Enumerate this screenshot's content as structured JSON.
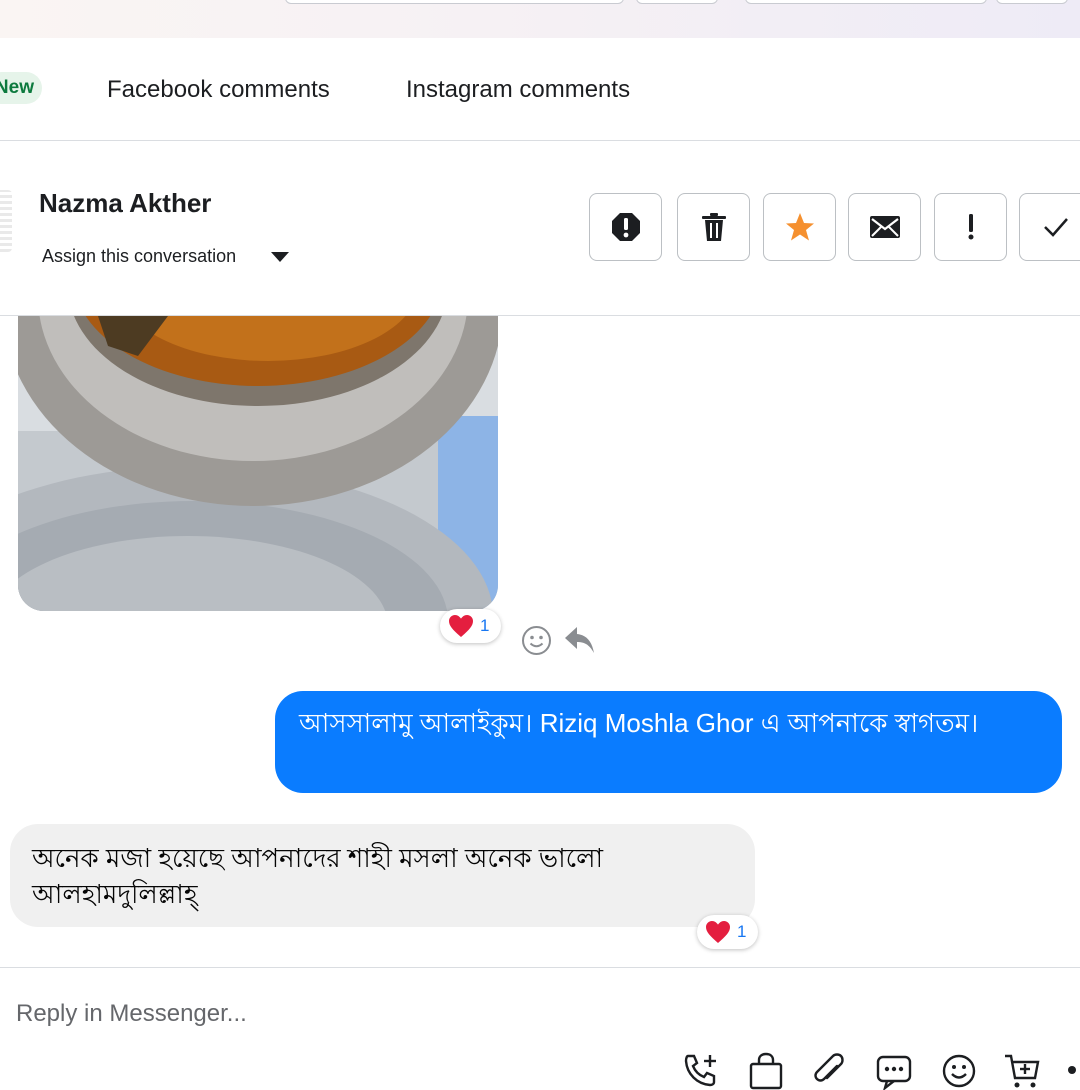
{
  "tabs": {
    "new_badge": "New",
    "facebook": "Facebook comments",
    "instagram": "Instagram comments"
  },
  "conversation": {
    "contact_name": "Nazma Akther",
    "assign_label": "Assign this conversation"
  },
  "actions": [
    {
      "icon": "spam-alert-icon"
    },
    {
      "icon": "trash-icon"
    },
    {
      "icon": "star-icon",
      "color": "#f5902f"
    },
    {
      "icon": "envelope-icon"
    },
    {
      "icon": "exclamation-icon"
    },
    {
      "icon": "checkmark-icon"
    }
  ],
  "messages": [
    {
      "type": "image",
      "direction": "incoming",
      "reaction": {
        "icon": "heart-icon",
        "count": "1"
      }
    },
    {
      "type": "text",
      "direction": "outgoing",
      "text": "আসসালামু আলাইকুম। Riziq Moshla Ghor এ আপনাকে স্বাগতম।"
    },
    {
      "type": "text",
      "direction": "incoming",
      "text": "অনেক মজা হয়েছে আপনাদের শাহী মসলা অনেক ভালো আলহামদুলিল্লাহ্",
      "reaction": {
        "icon": "heart-icon",
        "count": "1"
      }
    }
  ],
  "composer": {
    "placeholder": "Reply in Messenger...",
    "tools": [
      "call-add-icon",
      "shop-bag-icon",
      "attachment-icon",
      "saved-reply-icon",
      "emoji-icon",
      "add-to-cart-icon"
    ]
  },
  "colors": {
    "outgoing_bubble": "#0a7cff",
    "incoming_bubble": "#f0f0f0",
    "reaction_count": "#1877f2",
    "new_badge": "#e6f4ea"
  }
}
